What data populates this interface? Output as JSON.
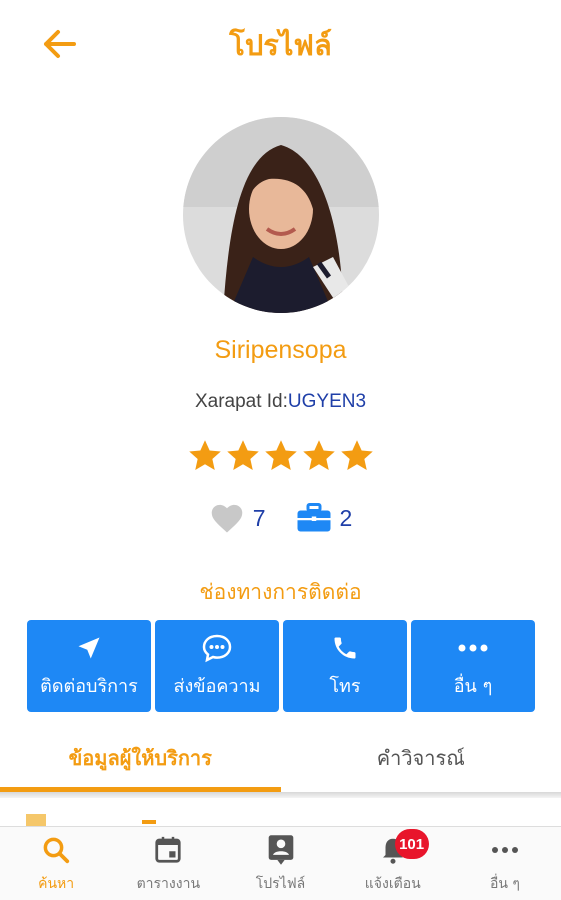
{
  "header": {
    "title": "โปรไฟล์",
    "back_icon": "arrow-left-icon"
  },
  "profile": {
    "avatar_icon": "profile-photo",
    "name": "Siripensopa",
    "id_label": "Xarapat Id:",
    "id_value": "UGYEN3",
    "rating": 5,
    "rating_max": 5,
    "likes": "7",
    "jobs": "2"
  },
  "contact": {
    "title": "ช่องทางการติดต่อ",
    "buttons": [
      {
        "label": "ติดต่อบริการ",
        "icon": "navigation-arrow-icon"
      },
      {
        "label": "ส่งข้อความ",
        "icon": "chat-bubble-icon"
      },
      {
        "label": "โทร",
        "icon": "phone-icon"
      },
      {
        "label": "อื่น ๆ",
        "icon": "more-dots-icon"
      }
    ]
  },
  "tabs": [
    {
      "label": "ข้อมูลผู้ให้บริการ",
      "active": true
    },
    {
      "label": "คำวิจารณ์",
      "active": false
    }
  ],
  "bottom_nav": [
    {
      "label": "ค้นหา",
      "icon": "search-icon",
      "active": true
    },
    {
      "label": "ตารางงาน",
      "icon": "calendar-icon",
      "active": false
    },
    {
      "label": "โปรไฟล์",
      "icon": "contact-card-icon",
      "active": false
    },
    {
      "label": "แจ้งเตือน",
      "icon": "bell-icon",
      "active": false,
      "badge": "101"
    },
    {
      "label": "อื่น ๆ",
      "icon": "more-dots-icon",
      "active": false
    }
  ],
  "colors": {
    "accent": "#f39c12",
    "button_blue": "#1e88f5",
    "link_blue": "#1f3fa8",
    "badge_red": "#e8152b"
  }
}
